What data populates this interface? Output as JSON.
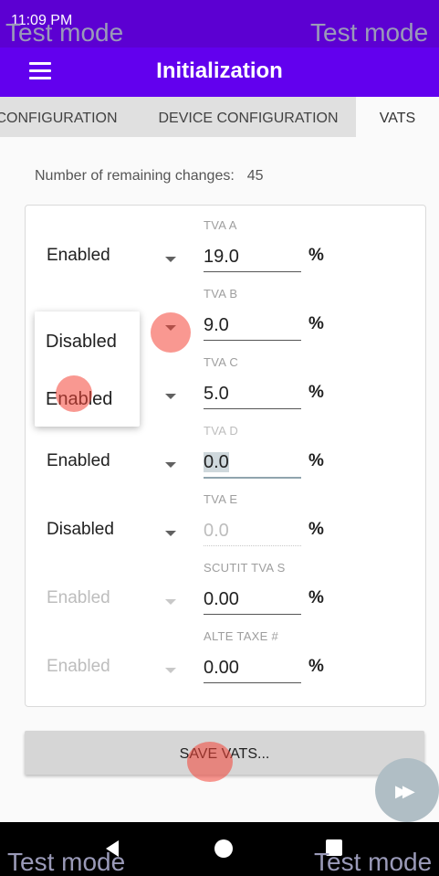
{
  "status_bar": {
    "time": "11:09 PM"
  },
  "watermark": "Test mode",
  "toolbar": {
    "title": "Initialization"
  },
  "tabs": [
    "CONFIGURATION",
    "DEVICE CONFIGURATION",
    "VATS"
  ],
  "remaining": {
    "label": "Number of remaining changes:",
    "count": "45"
  },
  "vat_rows": [
    {
      "label": "TVA A",
      "status": "Enabled",
      "value": "19.0",
      "unit": "%"
    },
    {
      "label": "TVA B",
      "status": "Disabled",
      "value": "9.0",
      "unit": "%"
    },
    {
      "label": "TVA C",
      "status": "Enabled",
      "value": "5.0",
      "unit": "%"
    },
    {
      "label": "TVA D",
      "status": "Enabled",
      "value": "0.0",
      "unit": "%"
    },
    {
      "label": "TVA E",
      "status": "Disabled",
      "value": "0.0",
      "unit": "%"
    },
    {
      "label": "SCUTIT TVA S",
      "status": "Enabled",
      "value": "0.00",
      "unit": "%"
    },
    {
      "label": "ALTE TAXE #",
      "status": "Enabled",
      "value": "0.00",
      "unit": "%"
    }
  ],
  "dropdown": {
    "options": [
      "Disabled",
      "Enabled"
    ]
  },
  "save_button": {
    "label": "SAVE VATS..."
  },
  "fab": {
    "icon": "fast-forward-icon"
  }
}
